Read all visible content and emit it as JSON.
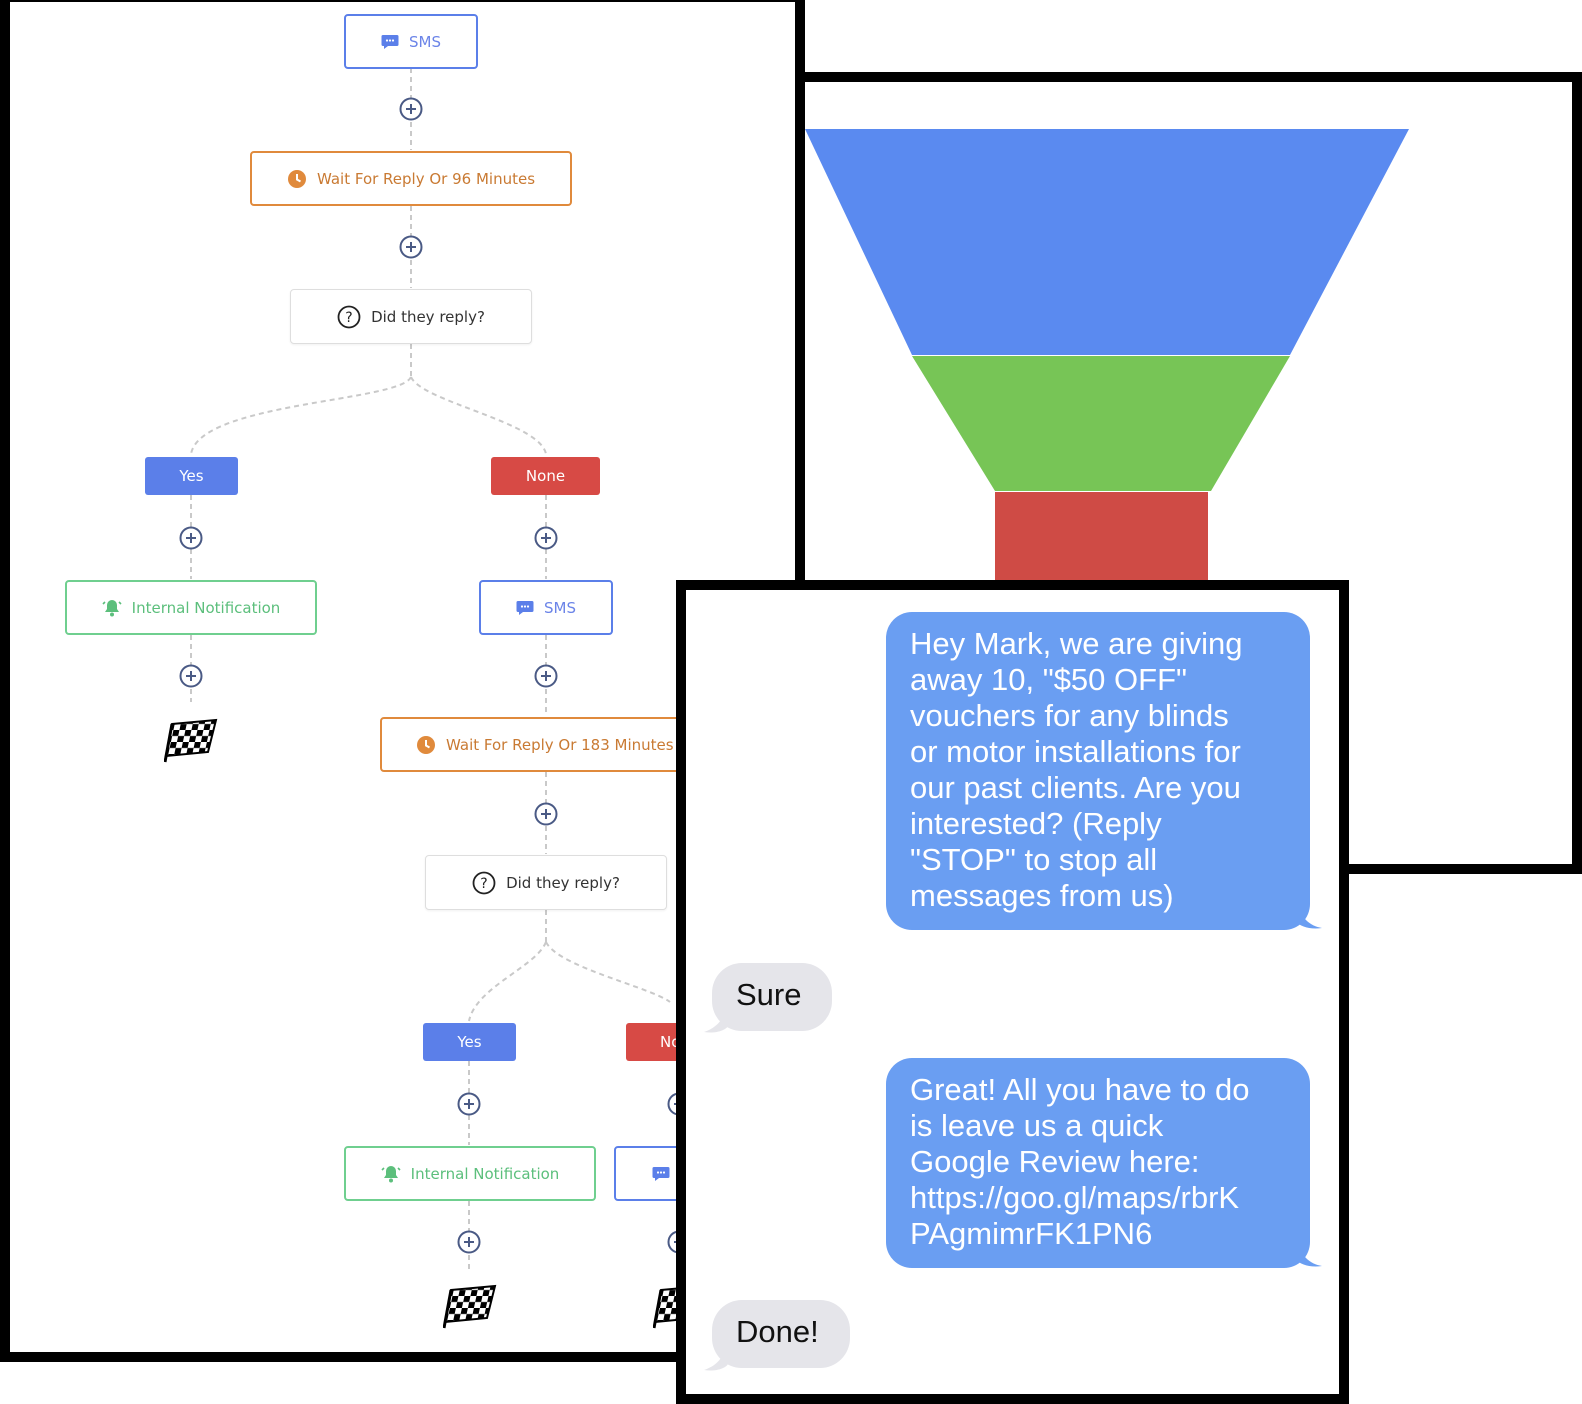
{
  "workflow": {
    "top_sms": "SMS",
    "wait_1": "Wait For Reply Or 96 Minutes",
    "condition_1": "Did they reply?",
    "yes_1": "Yes",
    "none_1": "None",
    "notification_1": "Internal Notification",
    "sms_2": "SMS",
    "wait_2": "Wait For Reply Or 183 Minutes",
    "condition_2": "Did they reply?",
    "yes_2": "Yes",
    "none_2_partial": "No",
    "notification_2": "Internal Notification"
  },
  "colors": {
    "sms": "#5b7fe9",
    "wait": "#e08a3c",
    "notification": "#6fcf8f",
    "yes": "#5b7fe9",
    "none": "#d74a45",
    "funnel_top": "#5a8af0",
    "funnel_middle": "#77c556",
    "funnel_bottom": "#cf4b45",
    "bubble_outgoing": "#6a9ef2",
    "bubble_incoming": "#e5e5ea"
  },
  "chat": {
    "message_1_lines": [
      "Hey Mark, we are giving",
      "away 10, \"$50 OFF\"",
      "vouchers for any blinds",
      "or motor installations for",
      "our past clients. Are you",
      "interested? (Reply",
      "\"STOP\" to stop all",
      "messages from us)"
    ],
    "reply_1": "Sure",
    "message_2_lines": [
      "Great! All you have to do",
      "is leave us a quick",
      "Google Review here:",
      "https://goo.gl/maps/rbrK",
      "PAgmimrFK1PN6"
    ],
    "reply_2": "Done!"
  }
}
